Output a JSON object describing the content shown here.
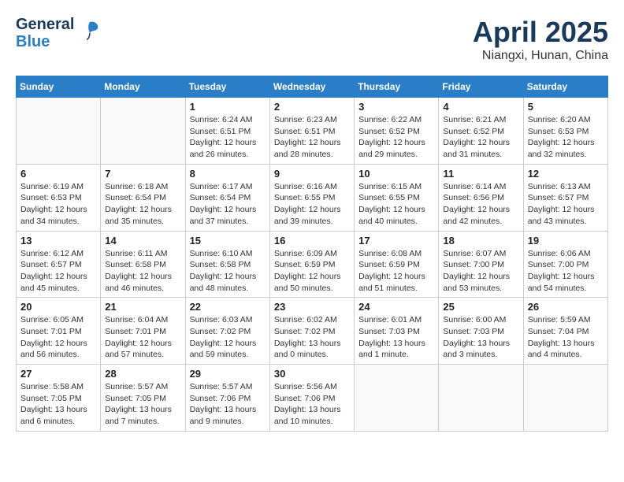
{
  "header": {
    "logo_line1": "General",
    "logo_line2": "Blue",
    "month": "April 2025",
    "location": "Niangxi, Hunan, China"
  },
  "weekdays": [
    "Sunday",
    "Monday",
    "Tuesday",
    "Wednesday",
    "Thursday",
    "Friday",
    "Saturday"
  ],
  "weeks": [
    [
      {
        "day": "",
        "info": ""
      },
      {
        "day": "",
        "info": ""
      },
      {
        "day": "1",
        "info": "Sunrise: 6:24 AM\nSunset: 6:51 PM\nDaylight: 12 hours\nand 26 minutes."
      },
      {
        "day": "2",
        "info": "Sunrise: 6:23 AM\nSunset: 6:51 PM\nDaylight: 12 hours\nand 28 minutes."
      },
      {
        "day": "3",
        "info": "Sunrise: 6:22 AM\nSunset: 6:52 PM\nDaylight: 12 hours\nand 29 minutes."
      },
      {
        "day": "4",
        "info": "Sunrise: 6:21 AM\nSunset: 6:52 PM\nDaylight: 12 hours\nand 31 minutes."
      },
      {
        "day": "5",
        "info": "Sunrise: 6:20 AM\nSunset: 6:53 PM\nDaylight: 12 hours\nand 32 minutes."
      }
    ],
    [
      {
        "day": "6",
        "info": "Sunrise: 6:19 AM\nSunset: 6:53 PM\nDaylight: 12 hours\nand 34 minutes."
      },
      {
        "day": "7",
        "info": "Sunrise: 6:18 AM\nSunset: 6:54 PM\nDaylight: 12 hours\nand 35 minutes."
      },
      {
        "day": "8",
        "info": "Sunrise: 6:17 AM\nSunset: 6:54 PM\nDaylight: 12 hours\nand 37 minutes."
      },
      {
        "day": "9",
        "info": "Sunrise: 6:16 AM\nSunset: 6:55 PM\nDaylight: 12 hours\nand 39 minutes."
      },
      {
        "day": "10",
        "info": "Sunrise: 6:15 AM\nSunset: 6:55 PM\nDaylight: 12 hours\nand 40 minutes."
      },
      {
        "day": "11",
        "info": "Sunrise: 6:14 AM\nSunset: 6:56 PM\nDaylight: 12 hours\nand 42 minutes."
      },
      {
        "day": "12",
        "info": "Sunrise: 6:13 AM\nSunset: 6:57 PM\nDaylight: 12 hours\nand 43 minutes."
      }
    ],
    [
      {
        "day": "13",
        "info": "Sunrise: 6:12 AM\nSunset: 6:57 PM\nDaylight: 12 hours\nand 45 minutes."
      },
      {
        "day": "14",
        "info": "Sunrise: 6:11 AM\nSunset: 6:58 PM\nDaylight: 12 hours\nand 46 minutes."
      },
      {
        "day": "15",
        "info": "Sunrise: 6:10 AM\nSunset: 6:58 PM\nDaylight: 12 hours\nand 48 minutes."
      },
      {
        "day": "16",
        "info": "Sunrise: 6:09 AM\nSunset: 6:59 PM\nDaylight: 12 hours\nand 50 minutes."
      },
      {
        "day": "17",
        "info": "Sunrise: 6:08 AM\nSunset: 6:59 PM\nDaylight: 12 hours\nand 51 minutes."
      },
      {
        "day": "18",
        "info": "Sunrise: 6:07 AM\nSunset: 7:00 PM\nDaylight: 12 hours\nand 53 minutes."
      },
      {
        "day": "19",
        "info": "Sunrise: 6:06 AM\nSunset: 7:00 PM\nDaylight: 12 hours\nand 54 minutes."
      }
    ],
    [
      {
        "day": "20",
        "info": "Sunrise: 6:05 AM\nSunset: 7:01 PM\nDaylight: 12 hours\nand 56 minutes."
      },
      {
        "day": "21",
        "info": "Sunrise: 6:04 AM\nSunset: 7:01 PM\nDaylight: 12 hours\nand 57 minutes."
      },
      {
        "day": "22",
        "info": "Sunrise: 6:03 AM\nSunset: 7:02 PM\nDaylight: 12 hours\nand 59 minutes."
      },
      {
        "day": "23",
        "info": "Sunrise: 6:02 AM\nSunset: 7:02 PM\nDaylight: 13 hours\nand 0 minutes."
      },
      {
        "day": "24",
        "info": "Sunrise: 6:01 AM\nSunset: 7:03 PM\nDaylight: 13 hours\nand 1 minute."
      },
      {
        "day": "25",
        "info": "Sunrise: 6:00 AM\nSunset: 7:03 PM\nDaylight: 13 hours\nand 3 minutes."
      },
      {
        "day": "26",
        "info": "Sunrise: 5:59 AM\nSunset: 7:04 PM\nDaylight: 13 hours\nand 4 minutes."
      }
    ],
    [
      {
        "day": "27",
        "info": "Sunrise: 5:58 AM\nSunset: 7:05 PM\nDaylight: 13 hours\nand 6 minutes."
      },
      {
        "day": "28",
        "info": "Sunrise: 5:57 AM\nSunset: 7:05 PM\nDaylight: 13 hours\nand 7 minutes."
      },
      {
        "day": "29",
        "info": "Sunrise: 5:57 AM\nSunset: 7:06 PM\nDaylight: 13 hours\nand 9 minutes."
      },
      {
        "day": "30",
        "info": "Sunrise: 5:56 AM\nSunset: 7:06 PM\nDaylight: 13 hours\nand 10 minutes."
      },
      {
        "day": "",
        "info": ""
      },
      {
        "day": "",
        "info": ""
      },
      {
        "day": "",
        "info": ""
      }
    ]
  ]
}
